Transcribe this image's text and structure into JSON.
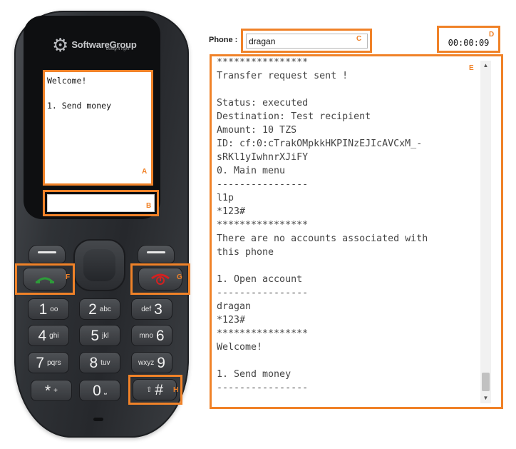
{
  "phone": {
    "logo_text": "SoftwareGroup",
    "logo_tagline": "doing it right",
    "screen_text": "Welcome!\n\n1. Send money",
    "keys": [
      {
        "num": "1",
        "letters": "oo"
      },
      {
        "num": "2",
        "letters": "abc"
      },
      {
        "num": "3",
        "letters": "def"
      },
      {
        "num": "4",
        "letters": "ghi"
      },
      {
        "num": "5",
        "letters": "jkl"
      },
      {
        "num": "6",
        "letters": "mno"
      },
      {
        "num": "7",
        "letters": "pqrs"
      },
      {
        "num": "8",
        "letters": "tuv"
      },
      {
        "num": "9",
        "letters": "wxyz"
      },
      {
        "num": "*",
        "letters": "+"
      },
      {
        "num": "0",
        "letters": "⎵"
      },
      {
        "num": "#",
        "letters": "⇧"
      }
    ]
  },
  "labels": {
    "a": "A",
    "b": "B",
    "c": "C",
    "d": "D",
    "e": "E",
    "f": "F",
    "g": "G",
    "h": "H"
  },
  "phone_field": {
    "label": "Phone :",
    "value": "dragan"
  },
  "timer": "00:00:09",
  "log_text": "****************\nTransfer request sent !\n\nStatus: executed\nDestination: Test recipient\nAmount: 10 TZS\nID: cf:0:cTrakOMpkkHKPINzEJIcAVCxM_-\nsRKl1yIwhnrXJiFY\n0. Main menu\n----------------\nl1p\n*123#\n****************\nThere are no accounts associated with\nthis phone\n\n1. Open account\n----------------\ndragan\n*123#\n****************\nWelcome!\n\n1. Send money\n----------------",
  "colors": {
    "highlight": "#f08228",
    "call_green": "#2e9b3a",
    "end_red": "#d42020"
  },
  "icons": [
    "call-icon",
    "end-call-icon",
    "voicemail-icon",
    "scroll-up-icon",
    "scroll-down-icon"
  ]
}
